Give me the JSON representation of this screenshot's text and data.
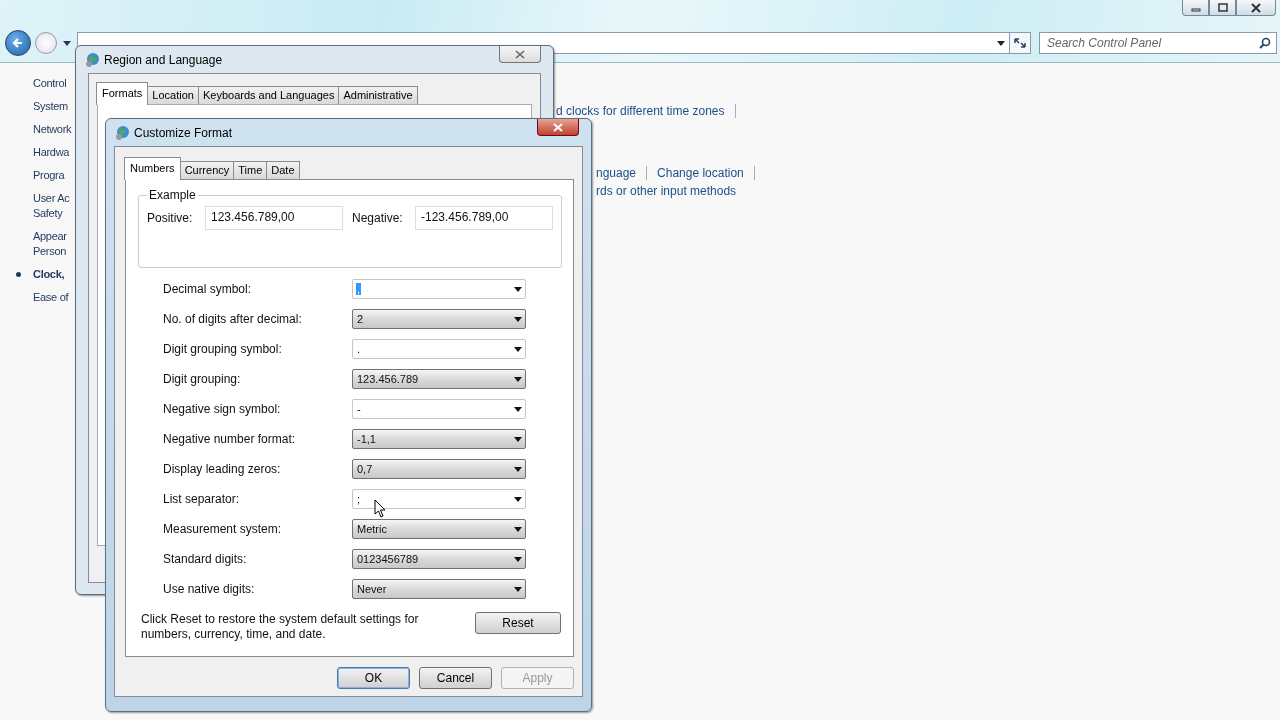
{
  "explorer": {
    "search": {
      "placeholder": "Search Control Panel"
    },
    "sidebar": {
      "items": [
        {
          "lines": [
            "Control"
          ],
          "selected": false
        },
        {
          "lines": [
            "System"
          ],
          "selected": false
        },
        {
          "lines": [
            "Network"
          ],
          "selected": false
        },
        {
          "lines": [
            "Hardwa"
          ],
          "selected": false
        },
        {
          "lines": [
            "Progra"
          ],
          "selected": false
        },
        {
          "lines": [
            "User Ac",
            "Safety"
          ],
          "selected": false
        },
        {
          "lines": [
            "Appear",
            "Person"
          ],
          "selected": false
        },
        {
          "lines": [
            "Clock,"
          ],
          "selected": true
        },
        {
          "lines": [
            "Ease of"
          ],
          "selected": false
        }
      ]
    },
    "link_rows": [
      [
        "d clocks for different time zones"
      ],
      [
        "nguage",
        "Change location"
      ],
      [
        "rds or other input methods"
      ]
    ]
  },
  "region_dialog": {
    "title": "Region and Language",
    "tabs": [
      {
        "label": "Formats",
        "selected": true
      },
      {
        "label": "Location",
        "selected": false
      },
      {
        "label": "Keyboards and Languages",
        "selected": false
      },
      {
        "label": "Administrative",
        "selected": false
      }
    ]
  },
  "customize_dialog": {
    "title": "Customize Format",
    "tabs": [
      {
        "label": "Numbers",
        "selected": true
      },
      {
        "label": "Currency",
        "selected": false
      },
      {
        "label": "Time",
        "selected": false
      },
      {
        "label": "Date",
        "selected": false
      }
    ],
    "example": {
      "title": "Example",
      "positive_label": "Positive:",
      "positive": "123.456.789,00",
      "negative_label": "Negative:",
      "negative": "-123.456.789,00"
    },
    "settings": [
      {
        "label": "Decimal symbol:",
        "value": ",",
        "kind": "editable",
        "focused": true
      },
      {
        "label": "No. of digits after decimal:",
        "value": "2",
        "kind": "list",
        "focused": false
      },
      {
        "label": "Digit grouping symbol:",
        "value": ".",
        "kind": "editable",
        "focused": false
      },
      {
        "label": "Digit grouping:",
        "value": "123.456.789",
        "kind": "list",
        "focused": false
      },
      {
        "label": "Negative sign symbol:",
        "value": "-",
        "kind": "editable",
        "focused": false
      },
      {
        "label": "Negative number format:",
        "value": "-1,1",
        "kind": "list",
        "focused": false
      },
      {
        "label": "Display leading zeros:",
        "value": "0,7",
        "kind": "list",
        "focused": false
      },
      {
        "label": "List separator:",
        "value": ";",
        "kind": "editable",
        "focused": false
      },
      {
        "label": "Measurement system:",
        "value": "Metric",
        "kind": "list",
        "focused": false
      },
      {
        "label": "Standard digits:",
        "value": "0123456789",
        "kind": "list",
        "focused": false
      },
      {
        "label": "Use native digits:",
        "value": "Never",
        "kind": "list",
        "focused": false
      }
    ],
    "note": "Click Reset to restore the system default settings for numbers, currency, time, and date.",
    "reset": "Reset",
    "buttons": [
      {
        "label": "OK",
        "default": true,
        "disabled": false
      },
      {
        "label": "Cancel",
        "default": false,
        "disabled": false
      },
      {
        "label": "Apply",
        "default": false,
        "disabled": true
      }
    ]
  }
}
